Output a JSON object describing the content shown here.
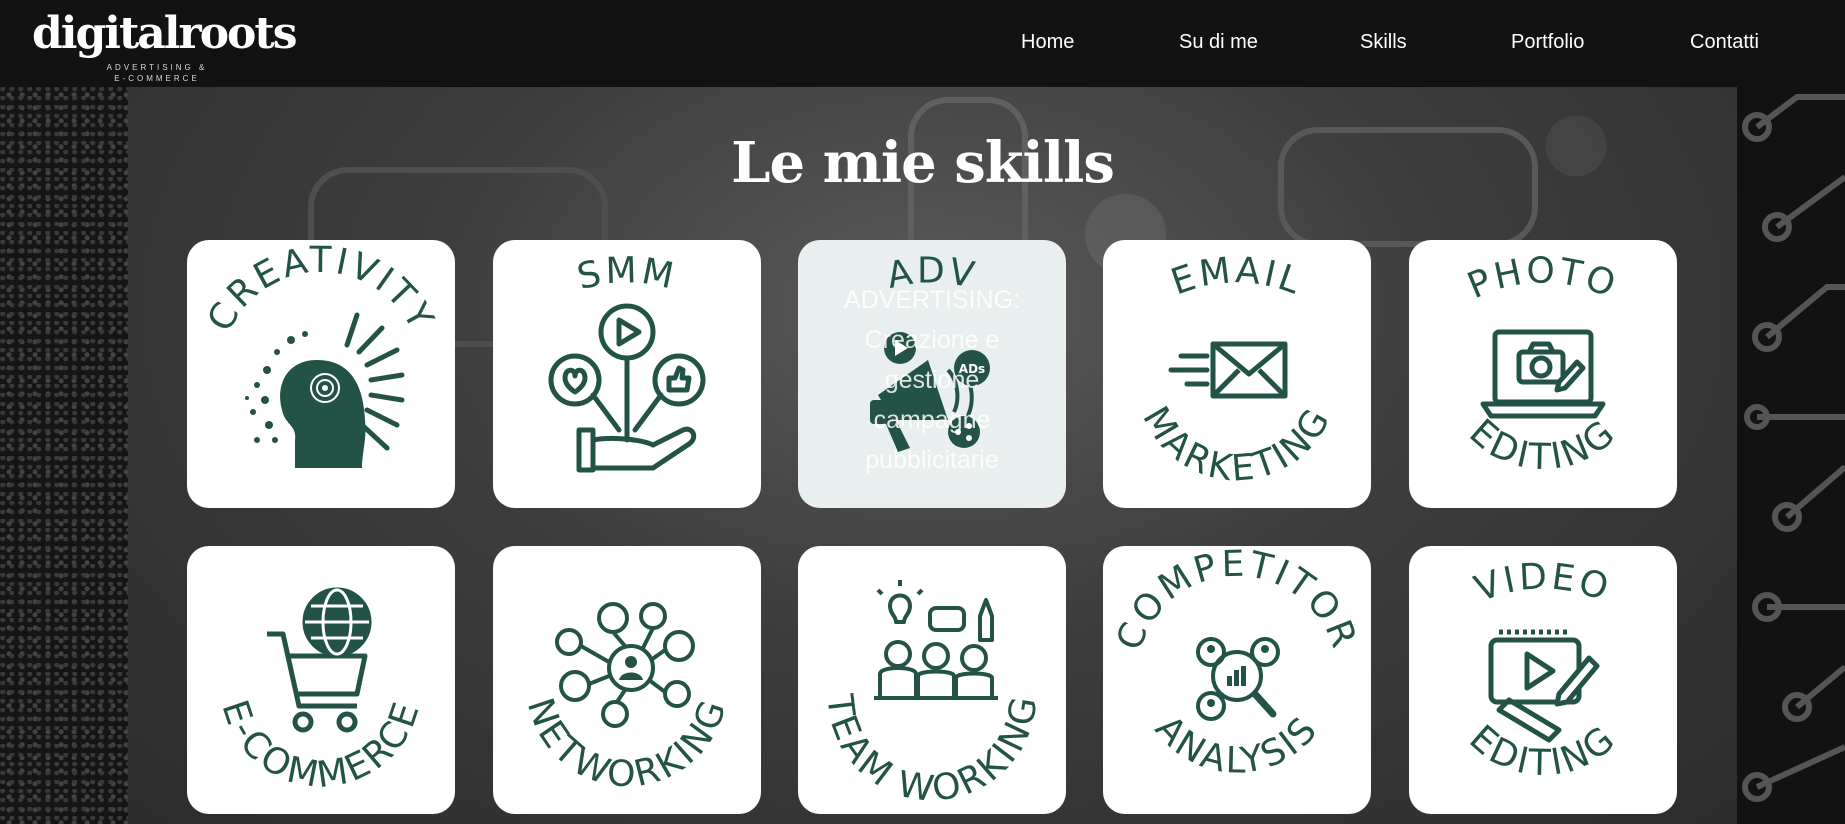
{
  "header": {
    "logo_text": "digitalroots",
    "logo_subtitle": "ADVERTISING & E-COMMERCE",
    "nav": [
      {
        "label": "Home"
      },
      {
        "label": "Su di me"
      },
      {
        "label": "Skills"
      },
      {
        "label": "Portfolio"
      },
      {
        "label": "Contatti"
      }
    ]
  },
  "skills": {
    "title": "Le mie skills",
    "cards": [
      {
        "top": "CREATIVITY",
        "bottom": "",
        "icon": "creative-head-icon"
      },
      {
        "top": "SMM",
        "bottom": "",
        "icon": "social-hand-icon"
      },
      {
        "top": "ADV",
        "bottom": "",
        "icon": "megaphone-icon",
        "hover_text": "ADVERTISING: Creazione e gestione campagne pubblicitarie"
      },
      {
        "top": "EMAIL",
        "bottom": "MARKETING",
        "icon": "envelope-icon"
      },
      {
        "top": "PHOTO",
        "bottom": "EDITING",
        "icon": "laptop-camera-icon"
      },
      {
        "top": "",
        "bottom": "E-COMMERCE",
        "icon": "cart-globe-icon"
      },
      {
        "top": "",
        "bottom": "NETWORKING",
        "icon": "network-people-icon"
      },
      {
        "top": "",
        "bottom": "TEAM WORKING",
        "icon": "team-icon"
      },
      {
        "top": "COMPETITOR",
        "bottom": "ANALYSIS",
        "icon": "magnifier-people-icon"
      },
      {
        "top": "VIDEO",
        "bottom": "EDITING",
        "icon": "video-screen-icon"
      }
    ]
  },
  "colors": {
    "accent": "#235346",
    "header_bg": "#121212",
    "card_bg": "#ffffff"
  }
}
